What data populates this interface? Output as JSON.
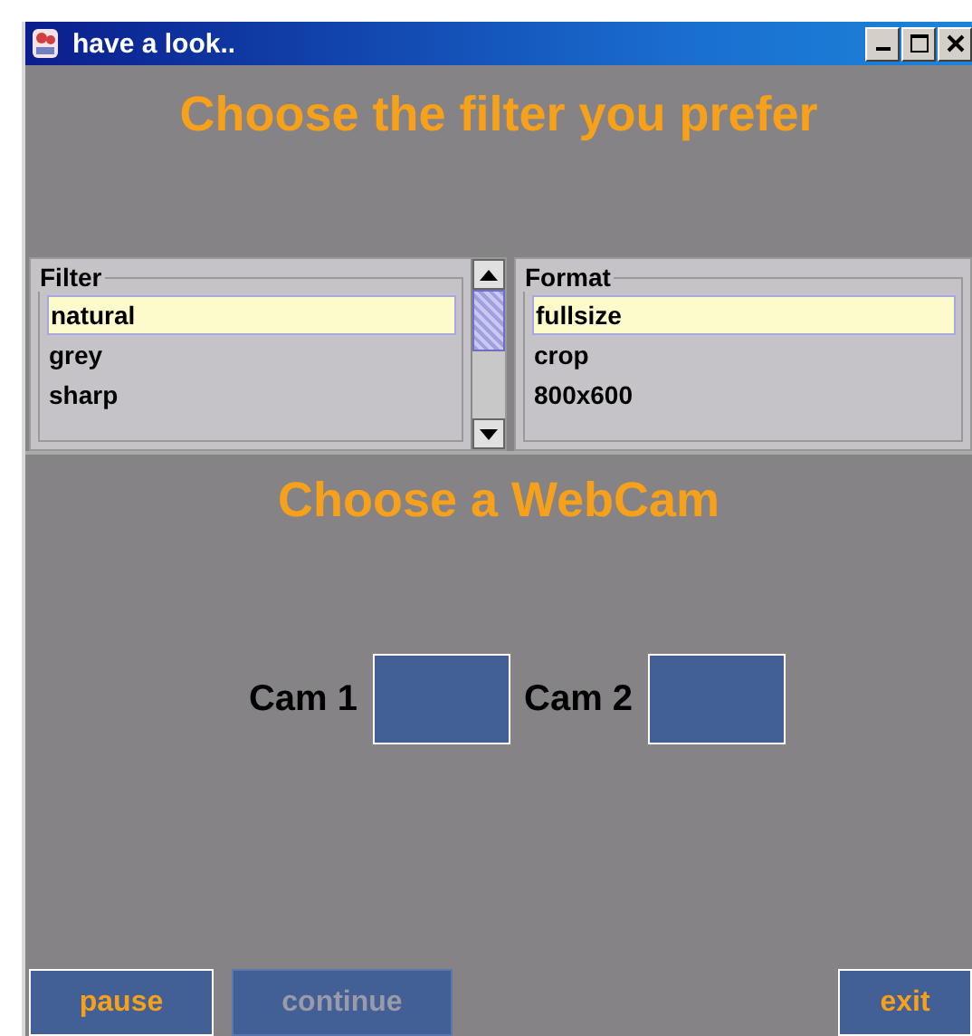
{
  "window": {
    "title": "have a look.."
  },
  "filter_heading": "Choose the filter you prefer",
  "lists": [
    {
      "title": "Filter",
      "scrollbar": true,
      "items": [
        {
          "label": "natural",
          "selected": true
        },
        {
          "label": "grey",
          "selected": false
        },
        {
          "label": "sharp",
          "selected": false
        }
      ]
    },
    {
      "title": "Format",
      "scrollbar": false,
      "items": [
        {
          "label": "fullsize",
          "selected": true
        },
        {
          "label": "crop",
          "selected": false
        },
        {
          "label": "800x600",
          "selected": false
        }
      ]
    }
  ],
  "webcam_heading": "Choose a WebCam",
  "cams": [
    {
      "label": "Cam 1"
    },
    {
      "label": "Cam 2"
    }
  ],
  "buttons": [
    {
      "label": "pause",
      "disabled": false
    },
    {
      "label": "continue",
      "disabled": true
    },
    {
      "label": "exit",
      "disabled": false
    }
  ]
}
